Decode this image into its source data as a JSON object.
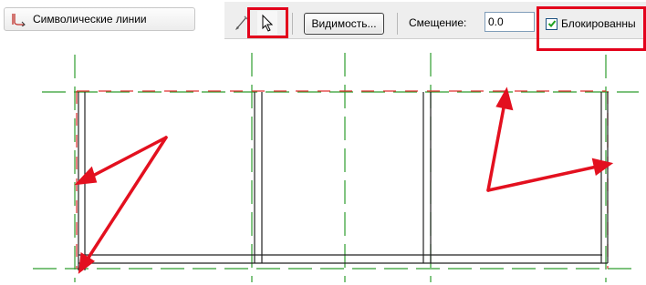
{
  "symbolic_lines_button": {
    "label": "Символические линии",
    "icon": "symbolic-line-icon"
  },
  "toolbar": {
    "draw_tool_icon": "pencil-icon",
    "select_tool_icon": "cursor-arrow-icon",
    "visibility_label": "Видимость...",
    "offset_label": "Смещение:",
    "offset_value": "0.0",
    "locked_label": "Блокированны",
    "locked_checked": true
  },
  "colors": {
    "highlight": "#e3001b",
    "arrow": "#e3101f",
    "dashed_green": "#2f9e2f",
    "dashed_red": "#e03030",
    "wall_line": "#222222"
  }
}
